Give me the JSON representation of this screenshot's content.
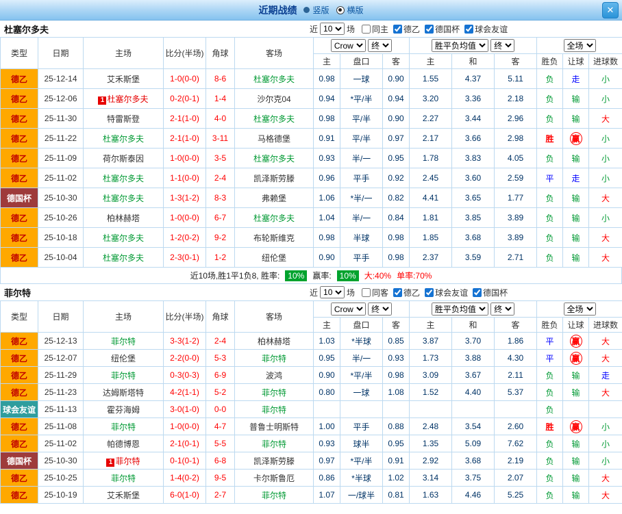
{
  "titlebar": {
    "title": "近期战绩",
    "radio_vertical": "竖版",
    "radio_horizontal": "横版",
    "close_label": "✕"
  },
  "sections": [
    {
      "team": "杜塞尔多夫",
      "filter": {
        "near_label": "近",
        "count": "10",
        "games_label": "场",
        "checks": [
          {
            "label": "同主",
            "on": false
          },
          {
            "label": "德乙",
            "on": true
          },
          {
            "label": "德国杯",
            "on": true
          },
          {
            "label": "球会友谊",
            "on": true
          }
        ]
      },
      "head": {
        "type": "类型",
        "date": "日期",
        "home": "主场",
        "score": "比分(半场)",
        "corner": "角球",
        "away": "客场",
        "odds_company": "Crow",
        "odds_stage": "终",
        "avg_label": "胜平负均值",
        "avg_stage": "终",
        "scope": "全场",
        "sub": [
          "主",
          "盘口",
          "客",
          "主",
          "和",
          "客",
          "胜负",
          "让球",
          "进球数"
        ]
      },
      "rows": [
        {
          "league": "德乙",
          "league_style": "de2",
          "date": "25-12-14",
          "home": "艾禾斯堡",
          "home_style": "",
          "home_badge": "",
          "score": "1-0(0-0)",
          "corners": "8-6",
          "away": "杜塞尔多夫",
          "away_style": "focus",
          "away_badge": "",
          "odds_home": "0.98",
          "handicap_line": "一球",
          "odds_away": "0.90",
          "avg_home": "1.55",
          "avg_draw": "4.37",
          "avg_away": "5.11",
          "result": "负",
          "result_style": "loss",
          "hcap_result": "走",
          "hcap_style": "push",
          "goals": "小",
          "goals_style": "small"
        },
        {
          "league": "德乙",
          "league_style": "de2",
          "date": "25-12-06",
          "home": "杜塞尔多夫",
          "home_style": "alert",
          "home_badge": "1",
          "score": "0-2(0-1)",
          "corners": "1-4",
          "away": "沙尔克04",
          "away_style": "",
          "away_badge": "",
          "odds_home": "0.94",
          "handicap_line": "*平/半",
          "odds_away": "0.94",
          "avg_home": "3.20",
          "avg_draw": "3.36",
          "avg_away": "2.18",
          "result": "负",
          "result_style": "loss",
          "hcap_result": "输",
          "hcap_style": "lose",
          "goals": "小",
          "goals_style": "small"
        },
        {
          "league": "德乙",
          "league_style": "de2",
          "date": "25-11-30",
          "home": "特雷斯登",
          "home_style": "",
          "home_badge": "",
          "score": "2-1(1-0)",
          "corners": "4-0",
          "away": "杜塞尔多夫",
          "away_style": "focus",
          "away_badge": "",
          "odds_home": "0.98",
          "handicap_line": "平/半",
          "odds_away": "0.90",
          "avg_home": "2.27",
          "avg_draw": "3.44",
          "avg_away": "2.96",
          "result": "负",
          "result_style": "loss",
          "hcap_result": "输",
          "hcap_style": "lose",
          "goals": "大",
          "goals_style": "big"
        },
        {
          "league": "德乙",
          "league_style": "de2",
          "date": "25-11-22",
          "home": "杜塞尔多夫",
          "home_style": "focus",
          "home_badge": "",
          "score": "2-1(1-0)",
          "corners": "3-11",
          "away": "马格德堡",
          "away_style": "",
          "away_badge": "",
          "odds_home": "0.91",
          "handicap_line": "平/半",
          "odds_away": "0.97",
          "avg_home": "2.17",
          "avg_draw": "3.66",
          "avg_away": "2.98",
          "result": "胜",
          "result_style": "win",
          "hcap_result": "赢",
          "hcap_style": "win-ring",
          "goals": "小",
          "goals_style": "small"
        },
        {
          "league": "德乙",
          "league_style": "de2",
          "date": "25-11-09",
          "home": "荷尔斯泰因",
          "home_style": "",
          "home_badge": "",
          "score": "1-0(0-0)",
          "corners": "3-5",
          "away": "杜塞尔多夫",
          "away_style": "focus",
          "away_badge": "",
          "odds_home": "0.93",
          "handicap_line": "半/一",
          "odds_away": "0.95",
          "avg_home": "1.78",
          "avg_draw": "3.83",
          "avg_away": "4.05",
          "result": "负",
          "result_style": "loss",
          "hcap_result": "输",
          "hcap_style": "lose",
          "goals": "小",
          "goals_style": "small"
        },
        {
          "league": "德乙",
          "league_style": "de2",
          "date": "25-11-02",
          "home": "杜塞尔多夫",
          "home_style": "focus",
          "home_badge": "",
          "score": "1-1(0-0)",
          "corners": "2-4",
          "away": "凯泽斯劳滕",
          "away_style": "",
          "away_badge": "",
          "odds_home": "0.96",
          "handicap_line": "平手",
          "odds_away": "0.92",
          "avg_home": "2.45",
          "avg_draw": "3.60",
          "avg_away": "2.59",
          "result": "平",
          "result_style": "draw",
          "hcap_result": "走",
          "hcap_style": "push",
          "goals": "小",
          "goals_style": "small"
        },
        {
          "league": "德国杯",
          "league_style": "cup",
          "date": "25-10-30",
          "home": "杜塞尔多夫",
          "home_style": "focus",
          "home_badge": "",
          "score": "1-3(1-2)",
          "corners": "8-3",
          "away": "弗赖堡",
          "away_style": "",
          "away_badge": "",
          "odds_home": "1.06",
          "handicap_line": "*半/一",
          "odds_away": "0.82",
          "avg_home": "4.41",
          "avg_draw": "3.65",
          "avg_away": "1.77",
          "result": "负",
          "result_style": "loss",
          "hcap_result": "输",
          "hcap_style": "lose",
          "goals": "大",
          "goals_style": "big"
        },
        {
          "league": "德乙",
          "league_style": "de2",
          "date": "25-10-26",
          "home": "柏林赫塔",
          "home_style": "",
          "home_badge": "",
          "score": "1-0(0-0)",
          "corners": "6-7",
          "away": "杜塞尔多夫",
          "away_style": "focus",
          "away_badge": "",
          "odds_home": "1.04",
          "handicap_line": "半/一",
          "odds_away": "0.84",
          "avg_home": "1.81",
          "avg_draw": "3.85",
          "avg_away": "3.89",
          "result": "负",
          "result_style": "loss",
          "hcap_result": "输",
          "hcap_style": "lose",
          "goals": "小",
          "goals_style": "small"
        },
        {
          "league": "德乙",
          "league_style": "de2",
          "date": "25-10-18",
          "home": "杜塞尔多夫",
          "home_style": "focus",
          "home_badge": "",
          "score": "1-2(0-2)",
          "corners": "9-2",
          "away": "布轮斯维克",
          "away_style": "",
          "away_badge": "",
          "odds_home": "0.98",
          "handicap_line": "半球",
          "odds_away": "0.98",
          "avg_home": "1.85",
          "avg_draw": "3.68",
          "avg_away": "3.89",
          "result": "负",
          "result_style": "loss",
          "hcap_result": "输",
          "hcap_style": "lose",
          "goals": "大",
          "goals_style": "big"
        },
        {
          "league": "德乙",
          "league_style": "de2",
          "date": "25-10-04",
          "home": "杜塞尔多夫",
          "home_style": "focus",
          "home_badge": "",
          "score": "2-3(0-1)",
          "corners": "1-2",
          "away": "纽伦堡",
          "away_style": "",
          "away_badge": "",
          "odds_home": "0.90",
          "handicap_line": "平手",
          "odds_away": "0.98",
          "avg_home": "2.37",
          "avg_draw": "3.59",
          "avg_away": "2.71",
          "result": "负",
          "result_style": "loss",
          "hcap_result": "输",
          "hcap_style": "lose",
          "goals": "大",
          "goals_style": "big"
        }
      ],
      "summary": {
        "prefix": "近10场,胜1平1负8, 胜率:",
        "win_rate": "10%",
        "mid_label": "赢率:",
        "handicap_rate": "10%",
        "big_label": "大:40%",
        "single_label": "单率:70%"
      }
    },
    {
      "team": "菲尔特",
      "filter": {
        "near_label": "近",
        "count": "10",
        "games_label": "场",
        "checks": [
          {
            "label": "同客",
            "on": false
          },
          {
            "label": "德乙",
            "on": true
          },
          {
            "label": "球会友谊",
            "on": true
          },
          {
            "label": "德国杯",
            "on": true
          }
        ]
      },
      "head": {
        "type": "类型",
        "date": "日期",
        "home": "主场",
        "score": "比分(半场)",
        "corner": "角球",
        "away": "客场",
        "odds_company": "Crow",
        "odds_stage": "终",
        "avg_label": "胜平负均值",
        "avg_stage": "终",
        "scope": "全场",
        "sub": [
          "主",
          "盘口",
          "客",
          "主",
          "和",
          "客",
          "胜负",
          "让球",
          "进球数"
        ]
      },
      "rows": [
        {
          "league": "德乙",
          "league_style": "de2",
          "date": "25-12-13",
          "home": "菲尔特",
          "home_style": "focus",
          "home_badge": "",
          "score": "3-3(1-2)",
          "corners": "2-4",
          "away": "柏林赫塔",
          "away_style": "",
          "away_badge": "",
          "odds_home": "1.03",
          "handicap_line": "*半球",
          "odds_away": "0.85",
          "avg_home": "3.87",
          "avg_draw": "3.70",
          "avg_away": "1.86",
          "result": "平",
          "result_style": "draw",
          "hcap_result": "赢",
          "hcap_style": "win-ring",
          "goals": "大",
          "goals_style": "big"
        },
        {
          "league": "德乙",
          "league_style": "de2",
          "date": "25-12-07",
          "home": "纽伦堡",
          "home_style": "",
          "home_badge": "",
          "score": "2-2(0-0)",
          "corners": "5-3",
          "away": "菲尔特",
          "away_style": "focus",
          "away_badge": "",
          "odds_home": "0.95",
          "handicap_line": "半/一",
          "odds_away": "0.93",
          "avg_home": "1.73",
          "avg_draw": "3.88",
          "avg_away": "4.30",
          "result": "平",
          "result_style": "draw",
          "hcap_result": "赢",
          "hcap_style": "win-ring",
          "goals": "大",
          "goals_style": "big"
        },
        {
          "league": "德乙",
          "league_style": "de2",
          "date": "25-11-29",
          "home": "菲尔特",
          "home_style": "focus",
          "home_badge": "",
          "score": "0-3(0-3)",
          "corners": "6-9",
          "away": "波鸿",
          "away_style": "",
          "away_badge": "",
          "odds_home": "0.90",
          "handicap_line": "*平/半",
          "odds_away": "0.98",
          "avg_home": "3.09",
          "avg_draw": "3.67",
          "avg_away": "2.11",
          "result": "负",
          "result_style": "loss",
          "hcap_result": "输",
          "hcap_style": "lose",
          "goals": "走",
          "goals_style": "push"
        },
        {
          "league": "德乙",
          "league_style": "de2",
          "date": "25-11-23",
          "home": "达姆斯塔特",
          "home_style": "",
          "home_badge": "",
          "score": "4-2(1-1)",
          "corners": "5-2",
          "away": "菲尔特",
          "away_style": "focus",
          "away_badge": "",
          "odds_home": "0.80",
          "handicap_line": "一球",
          "odds_away": "1.08",
          "avg_home": "1.52",
          "avg_draw": "4.40",
          "avg_away": "5.37",
          "result": "负",
          "result_style": "loss",
          "hcap_result": "输",
          "hcap_style": "lose",
          "goals": "大",
          "goals_style": "big"
        },
        {
          "league": "球会友谊",
          "league_style": "friendly",
          "date": "25-11-13",
          "home": "霍芬海姆",
          "home_style": "",
          "home_badge": "",
          "score": "3-0(1-0)",
          "corners": "0-0",
          "away": "菲尔特",
          "away_style": "focus",
          "away_badge": "",
          "odds_home": "",
          "handicap_line": "",
          "odds_away": "",
          "avg_home": "",
          "avg_draw": "",
          "avg_away": "",
          "result": "负",
          "result_style": "loss",
          "hcap_result": "",
          "hcap_style": "",
          "goals": "",
          "goals_style": ""
        },
        {
          "league": "德乙",
          "league_style": "de2",
          "date": "25-11-08",
          "home": "菲尔特",
          "home_style": "focus",
          "home_badge": "",
          "score": "1-0(0-0)",
          "corners": "4-7",
          "away": "普鲁士明斯特",
          "away_style": "",
          "away_badge": "",
          "odds_home": "1.00",
          "handicap_line": "平手",
          "odds_away": "0.88",
          "avg_home": "2.48",
          "avg_draw": "3.54",
          "avg_away": "2.60",
          "result": "胜",
          "result_style": "win",
          "hcap_result": "赢",
          "hcap_style": "win-ring",
          "goals": "小",
          "goals_style": "small"
        },
        {
          "league": "德乙",
          "league_style": "de2",
          "date": "25-11-02",
          "home": "帕德博恩",
          "home_style": "",
          "home_badge": "",
          "score": "2-1(0-1)",
          "corners": "5-5",
          "away": "菲尔特",
          "away_style": "focus",
          "away_badge": "",
          "odds_home": "0.93",
          "handicap_line": "球半",
          "odds_away": "0.95",
          "avg_home": "1.35",
          "avg_draw": "5.09",
          "avg_away": "7.62",
          "result": "负",
          "result_style": "loss",
          "hcap_result": "输",
          "hcap_style": "lose",
          "goals": "小",
          "goals_style": "small"
        },
        {
          "league": "德国杯",
          "league_style": "cup",
          "date": "25-10-30",
          "home": "菲尔特",
          "home_style": "alert",
          "home_badge": "1",
          "score": "0-1(0-1)",
          "corners": "6-8",
          "away": "凯泽斯劳滕",
          "away_style": "",
          "away_badge": "",
          "odds_home": "0.97",
          "handicap_line": "*平/半",
          "odds_away": "0.91",
          "avg_home": "2.92",
          "avg_draw": "3.68",
          "avg_away": "2.19",
          "result": "负",
          "result_style": "loss",
          "hcap_result": "输",
          "hcap_style": "lose",
          "goals": "小",
          "goals_style": "small"
        },
        {
          "league": "德乙",
          "league_style": "de2",
          "date": "25-10-25",
          "home": "菲尔特",
          "home_style": "focus",
          "home_badge": "",
          "score": "1-4(0-2)",
          "corners": "9-5",
          "away": "卡尔斯鲁厄",
          "away_style": "",
          "away_badge": "",
          "odds_home": "0.86",
          "handicap_line": "*半球",
          "odds_away": "1.02",
          "avg_home": "3.14",
          "avg_draw": "3.75",
          "avg_away": "2.07",
          "result": "负",
          "result_style": "loss",
          "hcap_result": "输",
          "hcap_style": "lose",
          "goals": "大",
          "goals_style": "big"
        },
        {
          "league": "德乙",
          "league_style": "de2",
          "date": "25-10-19",
          "home": "艾禾斯堡",
          "home_style": "",
          "home_badge": "",
          "score": "6-0(1-0)",
          "corners": "2-7",
          "away": "菲尔特",
          "away_style": "focus",
          "away_badge": "",
          "odds_home": "1.07",
          "handicap_line": "一/球半",
          "odds_away": "0.81",
          "avg_home": "1.63",
          "avg_draw": "4.46",
          "avg_away": "5.25",
          "result": "负",
          "result_style": "loss",
          "hcap_result": "输",
          "hcap_style": "lose",
          "goals": "大",
          "goals_style": "big"
        }
      ],
      "summary": null
    }
  ]
}
